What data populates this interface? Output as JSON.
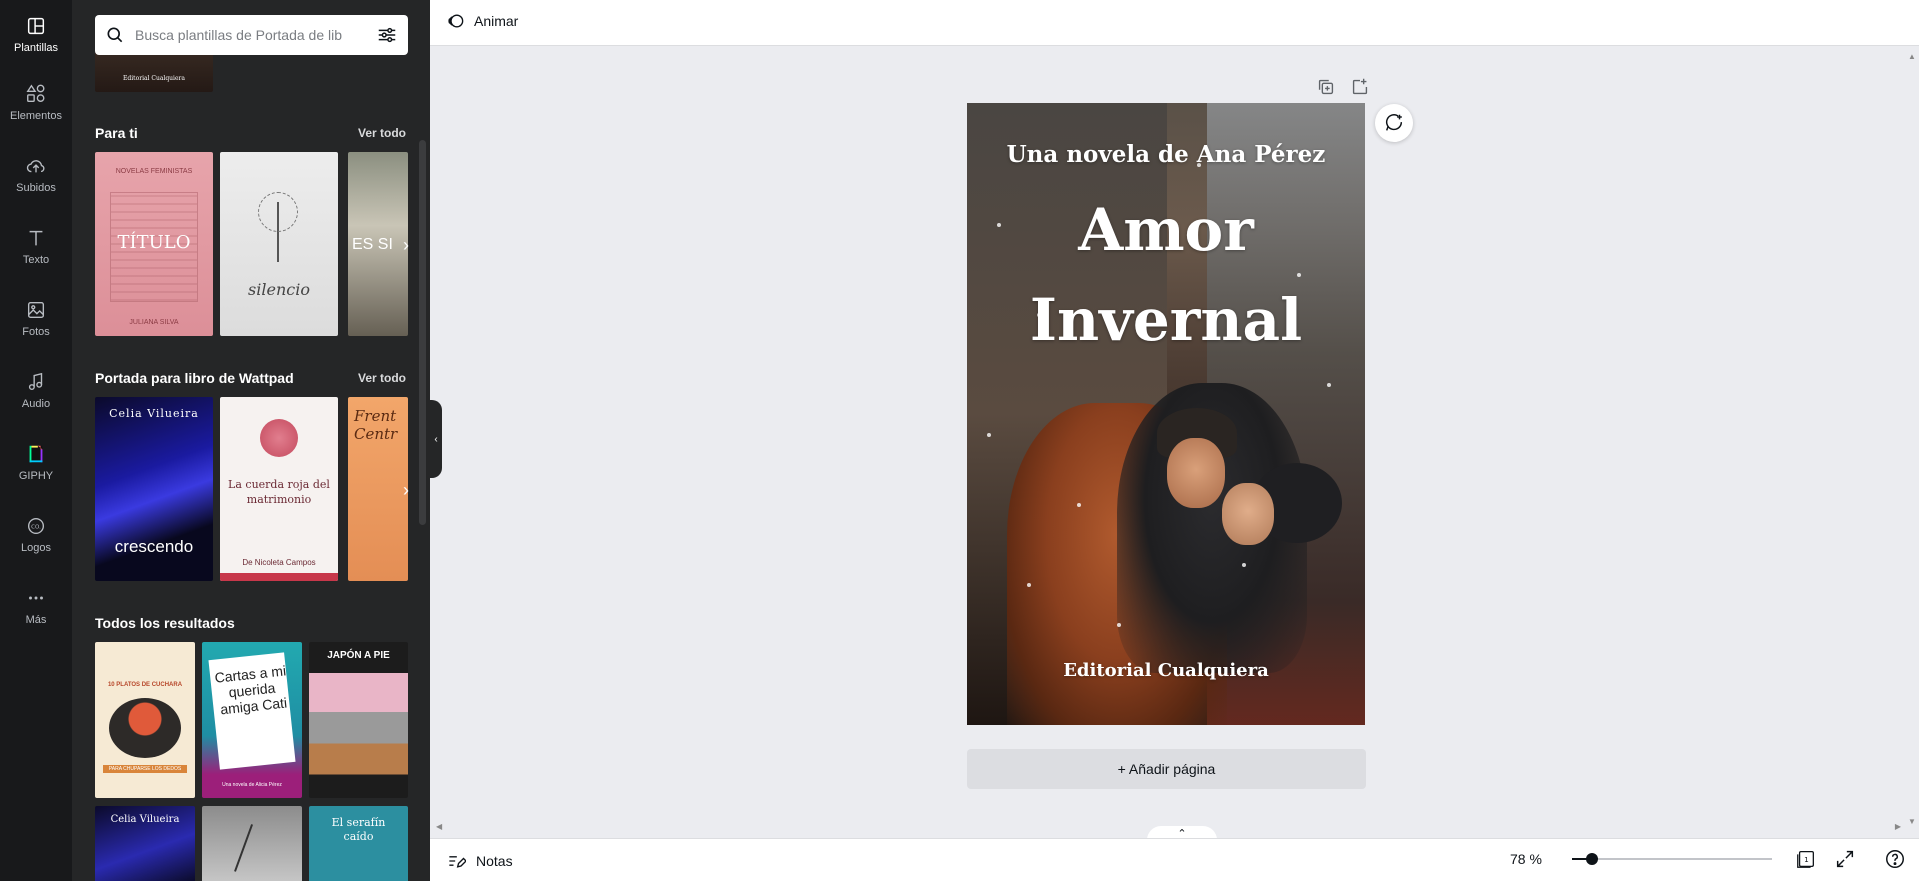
{
  "rail": {
    "items": [
      {
        "label": "Plantillas",
        "icon": "templates-icon",
        "active": true
      },
      {
        "label": "Elementos",
        "icon": "elements-icon"
      },
      {
        "label": "Subidos",
        "icon": "upload-icon"
      },
      {
        "label": "Texto",
        "icon": "text-icon"
      },
      {
        "label": "Fotos",
        "icon": "photos-icon"
      },
      {
        "label": "Audio",
        "icon": "audio-icon"
      },
      {
        "label": "GIPHY",
        "icon": "giphy-icon"
      },
      {
        "label": "Logos",
        "icon": "logos-icon"
      },
      {
        "label": "Más",
        "icon": "more-icon"
      }
    ]
  },
  "panel": {
    "search_placeholder": "Busca plantillas de Portada de lib",
    "top_thumb_text": "Editorial Cualquiera",
    "sections": [
      {
        "title": "Para ti",
        "see_all": "Ver todo",
        "thumbs": [
          {
            "top": "NOVELAS FEMINISTAS",
            "main": "TÍTULO",
            "bottom": "JULIANA SILVA"
          },
          {
            "main": "silencio",
            "bottom": ""
          },
          {
            "main": "ES SI"
          }
        ]
      },
      {
        "title": "Portada para libro de Wattpad",
        "see_all": "Ver todo",
        "thumbs": [
          {
            "top": "Celia Vilueira",
            "main": "crescendo"
          },
          {
            "main": "La cuerda roja del matrimonio",
            "bottom": "De Nicoleta Campos"
          },
          {
            "main": "Frent Centr"
          }
        ]
      },
      {
        "title": "Todos los resultados",
        "thumbs": [
          {
            "main": "10 PLATOS DE CUCHARA",
            "sub": "PARA CHUPARSE LOS DEDOS"
          },
          {
            "main": "Cartas a mi querida amiga Cati",
            "sub": "Una novela de Alicia Pérez"
          },
          {
            "main": "JAPÓN A PIE"
          },
          {
            "main": "Celia Vilueira"
          },
          {
            "main": ""
          },
          {
            "main": "El serafín caído"
          }
        ]
      }
    ]
  },
  "topbar": {
    "animate_label": "Animar"
  },
  "cover": {
    "subtitle": "Una novela de Ana Pérez",
    "title_line1": "Amor",
    "title_line2": "Invernal",
    "publisher": "Editorial Cualquiera"
  },
  "canvas": {
    "add_page_label": "+ Añadir página"
  },
  "bottombar": {
    "notes_label": "Notas",
    "zoom_label": "78 %",
    "zoom_fraction": 0.1,
    "page_count": "1"
  }
}
